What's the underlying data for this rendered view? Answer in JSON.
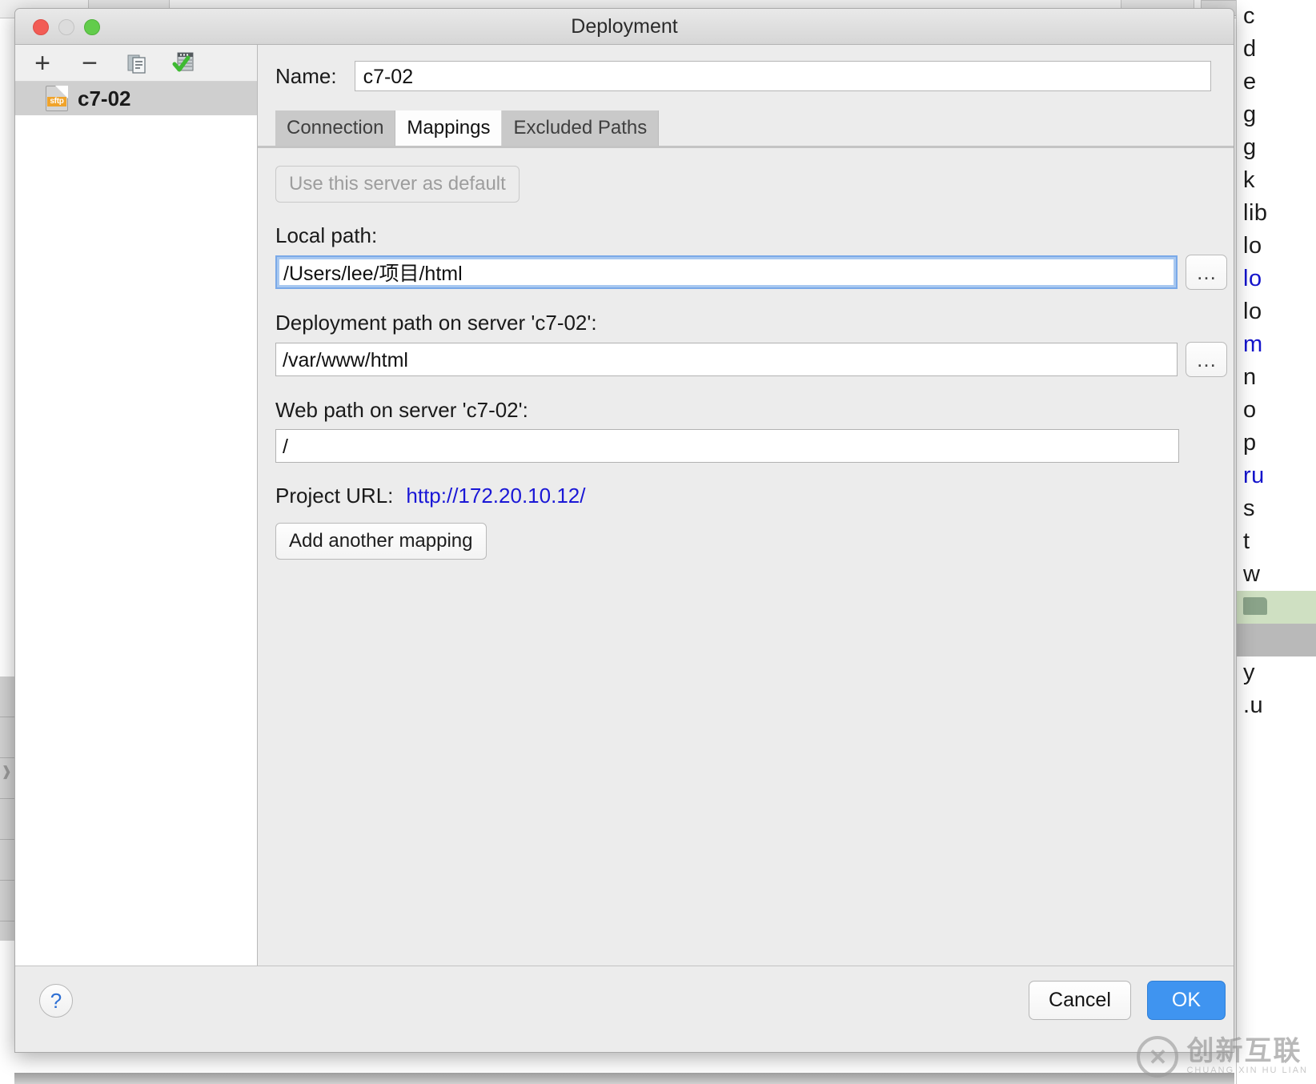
{
  "window": {
    "title": "Deployment",
    "traffic_lights": [
      "close",
      "minimize",
      "zoom"
    ]
  },
  "left_pane": {
    "toolbar": [
      {
        "name": "add",
        "glyph": "+"
      },
      {
        "name": "remove",
        "glyph": "−"
      },
      {
        "name": "copy",
        "glyph": ""
      },
      {
        "name": "set-default",
        "glyph": ""
      }
    ],
    "servers": [
      {
        "label": "c7-02",
        "icon_badge": "sftp",
        "selected": true
      }
    ]
  },
  "form": {
    "name_label": "Name:",
    "name_value": "c7-02",
    "tabs": [
      {
        "label": "Connection",
        "active": false
      },
      {
        "label": "Mappings",
        "active": true
      },
      {
        "label": "Excluded Paths",
        "active": false
      }
    ],
    "use_default_button": "Use this server as default",
    "use_default_disabled": true,
    "local_path_label": "Local path:",
    "local_path_value": "/Users/lee/项目/html",
    "deployment_path_label": "Deployment path on server 'c7-02':",
    "deployment_path_value": "/var/www/html",
    "web_path_label": "Web path on server 'c7-02':",
    "web_path_value": "/",
    "project_url_label": "Project URL:",
    "project_url_value": "http://172.20.10.12/",
    "add_mapping_button": "Add another mapping",
    "browse_glyph": "…"
  },
  "footer": {
    "help_glyph": "?",
    "cancel_label": "Cancel",
    "ok_label": "OK"
  },
  "watermark": {
    "logo_glyph": "✕",
    "cn_text": "创新互联",
    "en_text": "CHUANG XIN HU LIAN"
  },
  "background": {
    "tree_nodes": [
      {
        "text": "c",
        "style": "plain"
      },
      {
        "text": "d",
        "style": "plain"
      },
      {
        "text": "e",
        "style": "plain"
      },
      {
        "text": "g",
        "style": "plain"
      },
      {
        "text": "g",
        "style": "plain"
      },
      {
        "text": "k",
        "style": "plain"
      },
      {
        "text": "lib",
        "style": "plain"
      },
      {
        "text": "lo",
        "style": "plain"
      },
      {
        "text": "lo",
        "style": "link"
      },
      {
        "text": "lo",
        "style": "plain"
      },
      {
        "text": "m",
        "style": "link"
      },
      {
        "text": "n",
        "style": "plain"
      },
      {
        "text": "o",
        "style": "plain"
      },
      {
        "text": "p",
        "style": "plain"
      },
      {
        "text": "ru",
        "style": "link"
      },
      {
        "text": "s",
        "style": "plain"
      },
      {
        "text": "t",
        "style": "plain"
      },
      {
        "text": "w",
        "style": "plain"
      },
      {
        "text": "",
        "style": "sel-green"
      },
      {
        "text": "",
        "style": "sel-gray"
      },
      {
        "text": "y",
        "style": "plain"
      },
      {
        "text": ".u",
        "style": "plain"
      }
    ]
  },
  "colors": {
    "accent_blue": "#3f94f0",
    "link_blue": "#1a17d6",
    "dialog_bg": "#ececec",
    "selection_gray": "#cfcfcf"
  }
}
